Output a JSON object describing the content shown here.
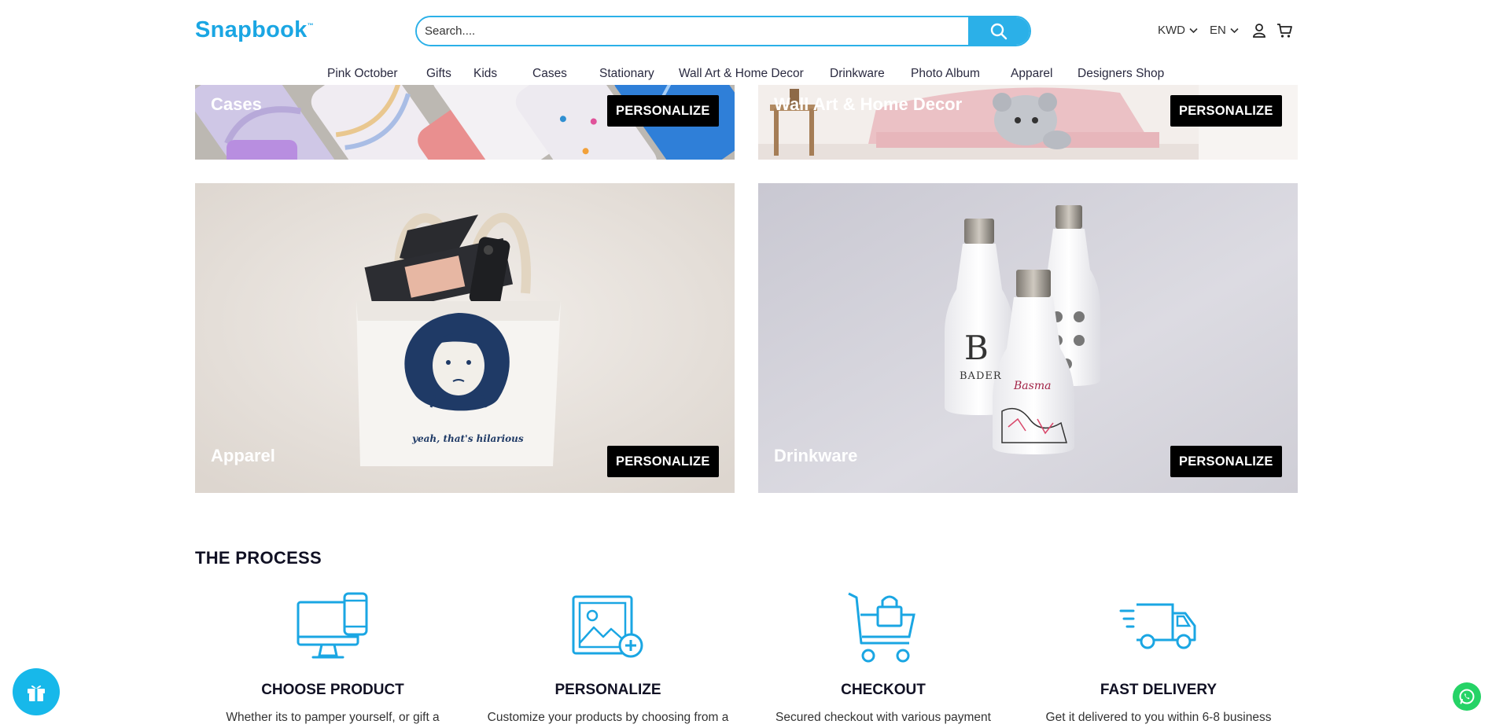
{
  "header": {
    "logo": "Snapbook",
    "logo_tm": "™",
    "search_placeholder": "Search....",
    "currency": "KWD",
    "language": "EN"
  },
  "nav": [
    "Pink October",
    "Gifts",
    "Kids",
    "Cases",
    "Stationary",
    "Wall Art & Home Decor",
    "Drinkware",
    "Photo Album",
    "Apparel",
    "Designers Shop"
  ],
  "tiles": [
    {
      "label": "Cases",
      "button": "PERSONALIZE"
    },
    {
      "label": "Wall Art & Home Decor",
      "button": "PERSONALIZE"
    },
    {
      "label": "Apparel",
      "button": "PERSONALIZE",
      "tote_text": "yeah, that's hilarious"
    },
    {
      "label": "Drinkware",
      "button": "PERSONALIZE",
      "bottle_letter": "B",
      "bottle_name": "BADER",
      "bottle_script": "Basma"
    }
  ],
  "process": {
    "title": "THE PROCESS",
    "steps": [
      {
        "title": "CHOOSE PRODUCT",
        "desc": "Whether its to pamper yourself, or gift a",
        "icon": "devices-icon"
      },
      {
        "title": "PERSONALIZE",
        "desc": "Customize your products by choosing from a",
        "icon": "image-plus-icon"
      },
      {
        "title": "CHECKOUT",
        "desc": "Secured checkout with various payment",
        "icon": "cart-lock-icon"
      },
      {
        "title": "FAST DELIVERY",
        "desc": "Get it delivered to you within 6-8 business",
        "icon": "delivery-truck-icon"
      }
    ]
  },
  "colors": {
    "accent": "#2bb0e8",
    "button": "#000000",
    "heading": "#111124",
    "whatsapp": "#25d366"
  }
}
